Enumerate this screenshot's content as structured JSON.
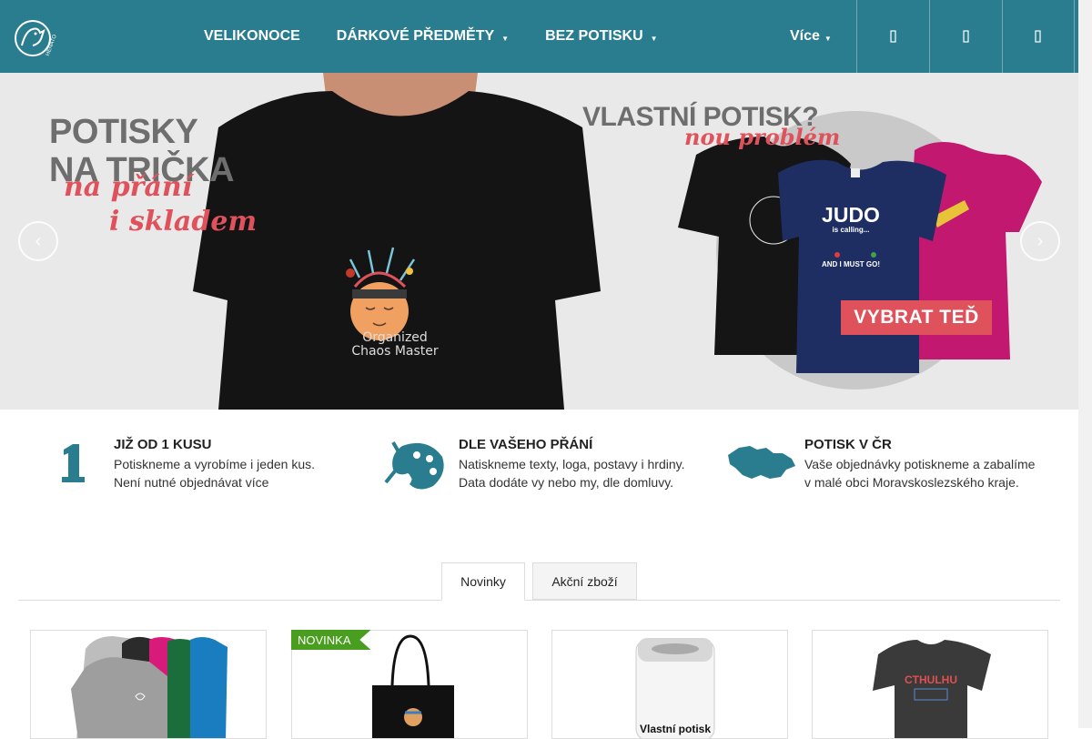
{
  "header": {
    "logo_text": "HENATO",
    "nav": [
      {
        "label": "VELIKONOCE",
        "has_dropdown": false
      },
      {
        "label": "DÁRKOVÉ PŘEDMĚTY",
        "has_dropdown": true
      },
      {
        "label": "BEZ POTISKU",
        "has_dropdown": true
      }
    ],
    "more_label": "Více",
    "icons": [
      "search-icon",
      "user-icon",
      "cart-icon"
    ],
    "background_color": "#2a7d8e"
  },
  "banner": {
    "left_title_line1": "POTISKY",
    "left_title_line2": "NA TRIČKA",
    "left_script_line1": "na přání",
    "left_script_line2": "i skladem",
    "shirt_print_line1": "Organized",
    "shirt_print_line2": "Chaos Master",
    "right_title": "VLASTNÍ POTISK?",
    "right_script": "nou problém",
    "judo_line1": "JUDO",
    "judo_line2": "is calling...",
    "judo_line3": "AND I MUST GO!",
    "cta_label": "VYBRAT TEĎ",
    "accent_color": "#e0525b"
  },
  "features": [
    {
      "icon": "number-one-icon",
      "title": "JIŽ OD 1 KUSU",
      "line1": "Potiskneme a vyrobíme i jeden kus.",
      "line2": "Není nutné objednávat více"
    },
    {
      "icon": "palette-brushes-icon",
      "title": "DLE VAŠEHO PŘÁNÍ",
      "line1": "Natiskneme texty, loga, postavy i hrdiny.",
      "line2": "Data dodáte vy nebo my, dle domluvy."
    },
    {
      "icon": "czech-map-icon",
      "title": "POTISK V ČR",
      "line1": "Vaše objednávky potiskneme a zabalíme",
      "line2": "v malé obci Moravskoslezského kraje."
    }
  ],
  "tabs": [
    {
      "label": "Novinky",
      "active": true
    },
    {
      "label": "Akční zboží",
      "active": false
    }
  ],
  "products": [
    {
      "image": "hoodie-dresses-image"
    },
    {
      "image": "tote-bag-image",
      "badge": "NOVINKA"
    },
    {
      "image": "thermo-can-image",
      "print_text": "Vlastní potisk"
    },
    {
      "image": "tshirt-cthulhu-image",
      "print_text": "CTHULHU"
    }
  ],
  "icon_color": "#2a7d8e"
}
